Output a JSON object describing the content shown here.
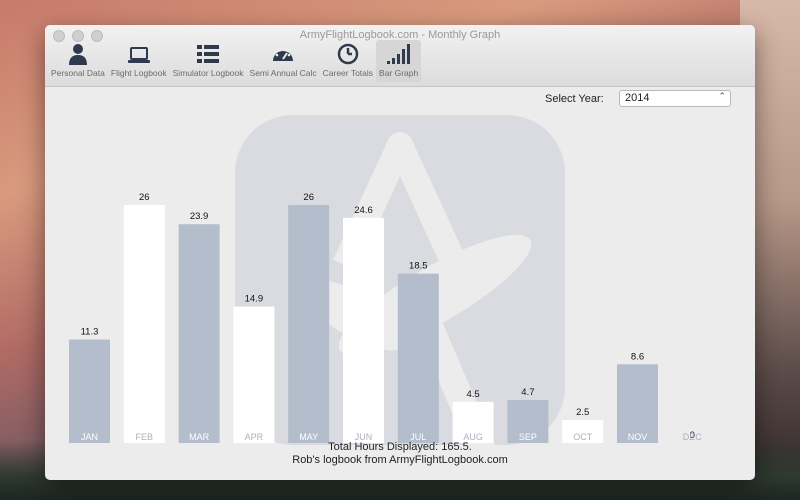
{
  "window": {
    "title": "ArmyFlightLogbook.com - Monthly Graph"
  },
  "toolbar": {
    "items": [
      {
        "label": "Personal Data",
        "icon": "person-icon"
      },
      {
        "label": "Flight Logbook",
        "icon": "laptop-icon"
      },
      {
        "label": "Simulator Logbook",
        "icon": "list-icon"
      },
      {
        "label": "Semi Annual Calc",
        "icon": "gauge-icon"
      },
      {
        "label": "Career Totals",
        "icon": "clock-icon"
      },
      {
        "label": "Bar Graph",
        "icon": "bar-graph-icon"
      }
    ],
    "active": "Bar Graph"
  },
  "year_selector": {
    "label": "Select Year:",
    "value": "2014"
  },
  "footer": {
    "total": "Total Hours Displayed: 165.5.",
    "owner": "Rob's  logbook from ArmyFlightLogbook.com"
  },
  "colors": {
    "bar_filled": "#b4bdcb",
    "bar_light": "#ffffff",
    "label_on_filled": "#ffffff",
    "label_on_light": "#a9b1bf"
  },
  "chart_data": {
    "type": "bar",
    "categories": [
      "JAN",
      "FEB",
      "MAR",
      "APR",
      "MAY",
      "JUN",
      "JUL",
      "AUG",
      "SEP",
      "OCT",
      "NOV",
      "DEC"
    ],
    "values": [
      11.3,
      26,
      23.9,
      14.9,
      26,
      24.6,
      18.5,
      4.5,
      4.7,
      2.5,
      8.6,
      0
    ],
    "value_labels": [
      "11.3",
      "26",
      "23.9",
      "14.9",
      "26",
      "24.6",
      "18.5",
      "4.5",
      "4.7",
      "2.5",
      "8.6",
      "0"
    ],
    "ylim": [
      0,
      26
    ],
    "grid": false,
    "title": "",
    "xlabel": "",
    "ylabel": ""
  }
}
